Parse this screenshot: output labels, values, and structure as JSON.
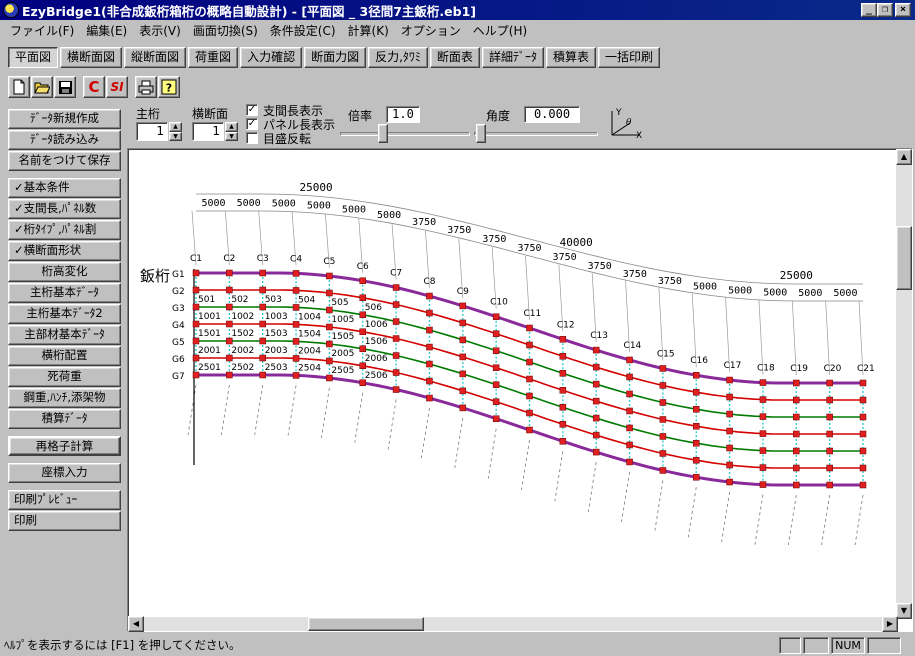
{
  "window": {
    "title": "EzyBridge1(非合成鈑桁箱桁の概略自動設計) - [平面図 _ 3径間7主鈑桁.eb1]",
    "minimize": "_",
    "restore": "❐",
    "close": "×"
  },
  "menu": [
    "ファイル(F)",
    "編集(E)",
    "表示(V)",
    "画面切換(S)",
    "条件設定(C)",
    "計算(K)",
    "オプション",
    "ヘルプ(H)"
  ],
  "view_tabs": [
    "平面図",
    "横断面図",
    "縦断面図",
    "荷重図",
    "入力確認",
    "断面力図",
    "反力,ﾀﾜﾐ",
    "断面表",
    "詳細ﾃﾞｰﾀ",
    "積算表",
    "一括印刷"
  ],
  "active_view_tab": "平面図",
  "toolbar": {
    "new": "new-file-icon",
    "open": "open-folder-icon",
    "save": "save-disk-icon",
    "c_button": "C",
    "si_button": "SI",
    "print": "printer-icon",
    "help": "?"
  },
  "sidebar": {
    "file_group": [
      "ﾃﾞｰﾀ新規作成",
      "ﾃﾞｰﾀ読み込み",
      "名前をつけて保存"
    ],
    "input_group": [
      "✓基本条件",
      "✓支間長,ﾊﾟﾈﾙ数",
      "✓桁ﾀｲﾌﾟ,ﾊﾟﾈﾙ割",
      "✓横断面形状",
      "桁高変化",
      "主桁基本ﾃﾞｰﾀ",
      "主桁基本ﾃﾞｰﾀ2",
      "主部材基本ﾃﾞｰﾀ",
      "横桁配置",
      "死荷重",
      "鋼重,ﾊﾝﾁ,添架物",
      "積算ﾃﾞｰﾀ"
    ],
    "recalc": "再格子計算",
    "coord_input": "座標入力",
    "print_group": [
      "印刷ﾌﾟﾚﾋﾞｭｰ",
      "印刷"
    ]
  },
  "params": {
    "main_girder_label": "主桁",
    "main_girder_value": "1",
    "cross_section_label": "横断面",
    "cross_section_value": "1",
    "chk_span_length": {
      "label": "支間長表示",
      "checked": true
    },
    "chk_panel_length": {
      "label": "パネル長表示",
      "checked": true
    },
    "chk_scale_flip": {
      "label": "目盛反転",
      "checked": false
    },
    "scale_label": "倍率",
    "scale_value": "1.0",
    "angle_label": "角度",
    "angle_value": "0.000",
    "axis_x": "X",
    "axis_y": "Y",
    "axis_theta": "θ"
  },
  "drawing": {
    "girder_type_label": "鈑桁",
    "span_totals": [
      "25000",
      "40000",
      "25000"
    ],
    "panel_lengths_top": [
      "5000",
      "5000",
      "5000",
      "5000",
      "5000",
      "5000",
      "3750",
      "3750",
      "3750",
      "3750",
      "3750",
      "3750",
      "3750",
      "3750",
      "5000",
      "5000",
      "5000",
      "5000",
      "5000"
    ],
    "cross_beam_labels": [
      "C1",
      "C2",
      "C3",
      "C4",
      "C5",
      "C6",
      "C7",
      "C8",
      "C9",
      "C10",
      "C11",
      "C12",
      "C13",
      "C14",
      "C15",
      "C16",
      "C17",
      "C18",
      "C19",
      "C20",
      "C21"
    ],
    "girder_labels": [
      "G1",
      "G2",
      "G3",
      "G4",
      "G5",
      "G6",
      "G7"
    ],
    "node_labels_sample": [
      "501",
      "502",
      "503",
      "504",
      "505",
      "506",
      "1001",
      "1002",
      "1003",
      "1004",
      "1005",
      "1006",
      "1501",
      "1502",
      "1503",
      "1504",
      "1505",
      "1506",
      "2001",
      "2002",
      "2003",
      "2004",
      "2005",
      "2006",
      "2501",
      "2502",
      "2503",
      "2504",
      "2505",
      "2506"
    ]
  },
  "status": {
    "help_text": "ﾍﾙﾌﾟを表示するには [F1] を押してください。",
    "num": "NUM"
  },
  "colors": {
    "titlebar": "#000080",
    "face": "#c0c0c0",
    "girder_red": "#d40000",
    "girder_green": "#007a00",
    "girder_purple": "#8a2a9a",
    "crossbeam_cyan": "#33cccc",
    "node_marker": "#e02020"
  }
}
